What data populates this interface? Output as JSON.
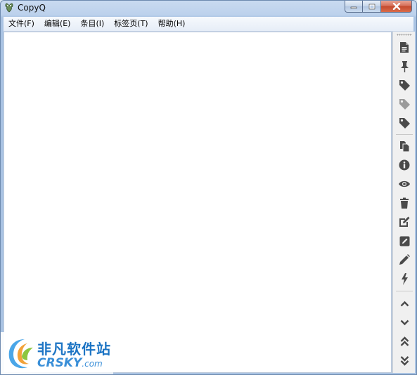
{
  "window": {
    "title": "CopyQ",
    "app_icon": "copyq-icon"
  },
  "caption_buttons": [
    {
      "name": "minimize-button",
      "icon": "minimize-icon"
    },
    {
      "name": "maximize-button",
      "icon": "maximize-icon"
    },
    {
      "name": "close-button",
      "icon": "close-icon"
    }
  ],
  "menu": {
    "items": [
      {
        "label": "文件(F)"
      },
      {
        "label": "编辑(E)"
      },
      {
        "label": "条目(I)"
      },
      {
        "label": "标签页(T)"
      },
      {
        "label": "帮助(H)"
      }
    ]
  },
  "toolbar": {
    "buttons": [
      {
        "icon": "new-item-icon"
      },
      {
        "icon": "pin-icon"
      },
      {
        "icon": "tag-icon"
      },
      {
        "icon": "tag-gray-icon"
      },
      {
        "icon": "tag-dark-icon"
      },
      {
        "icon": "copy-icon"
      },
      {
        "icon": "info-icon"
      },
      {
        "icon": "eye-icon"
      },
      {
        "icon": "trash-icon"
      },
      {
        "icon": "edit-icon"
      },
      {
        "icon": "edit-notes-icon"
      },
      {
        "icon": "pencil-icon"
      },
      {
        "icon": "lightning-icon"
      },
      {
        "icon": "chevron-up-icon"
      },
      {
        "icon": "chevron-down-icon"
      },
      {
        "icon": "double-chevron-up-icon"
      },
      {
        "icon": "double-chevron-down-icon"
      }
    ]
  },
  "watermark": {
    "text_cn": "非凡软件站",
    "text_en": "CRSKY",
    "domain": ".com"
  },
  "colors": {
    "icon": "#4a4a4a",
    "icon_light": "#9a9a9a",
    "watermark_blue": "#1c74c4"
  }
}
